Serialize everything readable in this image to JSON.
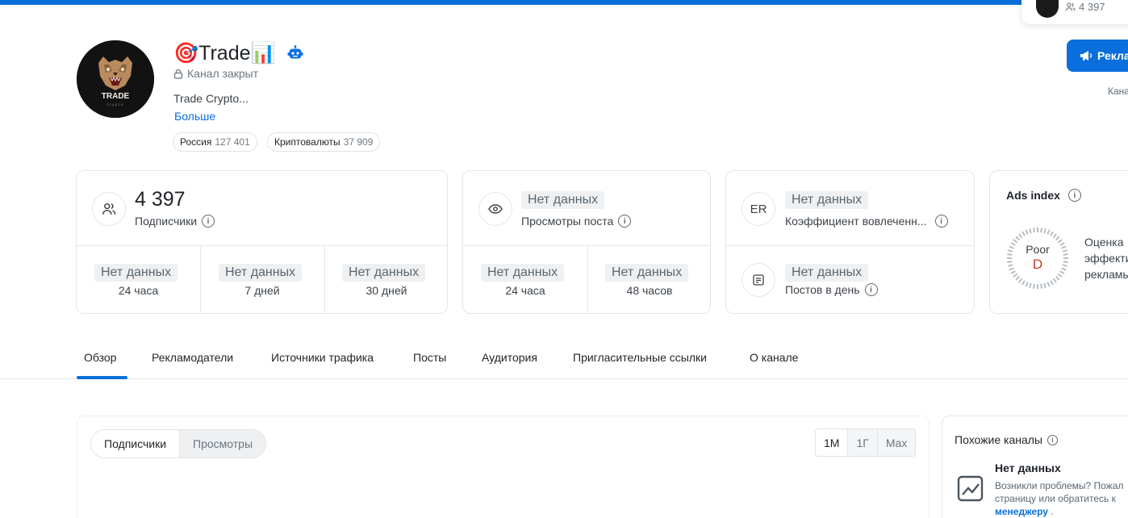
{
  "mini_card": {
    "subscribers": "4 397"
  },
  "channel": {
    "title": "🎯Trade📊",
    "status": "Канал закрыт",
    "description": "Trade Crypto...",
    "more_link": "Больше",
    "avatar_text": "TRADE",
    "avatar_subtext": "crypto",
    "tags": [
      {
        "label": "Россия",
        "count": "127 401"
      },
      {
        "label": "Криптовалюты",
        "count": "37 909"
      }
    ]
  },
  "ad_button": {
    "label": "Рекла",
    "subtext": "Кана"
  },
  "stats": {
    "subscribers": {
      "value": "4 397",
      "label": "Подписчики",
      "periods": [
        {
          "value": "Нет данных",
          "label": "24 часа"
        },
        {
          "value": "Нет данных",
          "label": "7 дней"
        },
        {
          "value": "Нет данных",
          "label": "30 дней"
        }
      ]
    },
    "views": {
      "value": "Нет данных",
      "label": "Просмотры поста",
      "periods": [
        {
          "value": "Нет данных",
          "label": "24 часа"
        },
        {
          "value": "Нет данных",
          "label": "48 часов"
        }
      ]
    },
    "engagement": {
      "icon_text": "ER",
      "value": "Нет данных",
      "label": "Коэффициент вовлеченн...",
      "posts_value": "Нет данных",
      "posts_label": "Постов в день"
    },
    "ads_index": {
      "title": "Ads index",
      "grade_label": "Poor",
      "grade": "D",
      "text_line1": "Оценка",
      "text_line2": "эффекти",
      "text_line3": "рекламы"
    }
  },
  "tabs": [
    {
      "label": "Обзор",
      "active": true
    },
    {
      "label": "Рекламодатели"
    },
    {
      "label": "Источники трафика"
    },
    {
      "label": "Посты"
    },
    {
      "label": "Аудитория"
    },
    {
      "label": "Пригласительные ссылки"
    },
    {
      "label": "О канале"
    }
  ],
  "chart": {
    "segments": [
      "Подписчики",
      "Просмотры"
    ],
    "ranges": [
      "1М",
      "1Г",
      "Max"
    ]
  },
  "similar": {
    "title": "Похожие каналы",
    "nodata": "Нет данных",
    "text_line1": "Возникли проблемы? Пожал",
    "text_line2": "страницу или обратитесь к",
    "link": "менеджеру",
    "tail": " ."
  },
  "colors": {
    "accent": "#0a6fdc",
    "grade_poor": "#c0392b"
  }
}
